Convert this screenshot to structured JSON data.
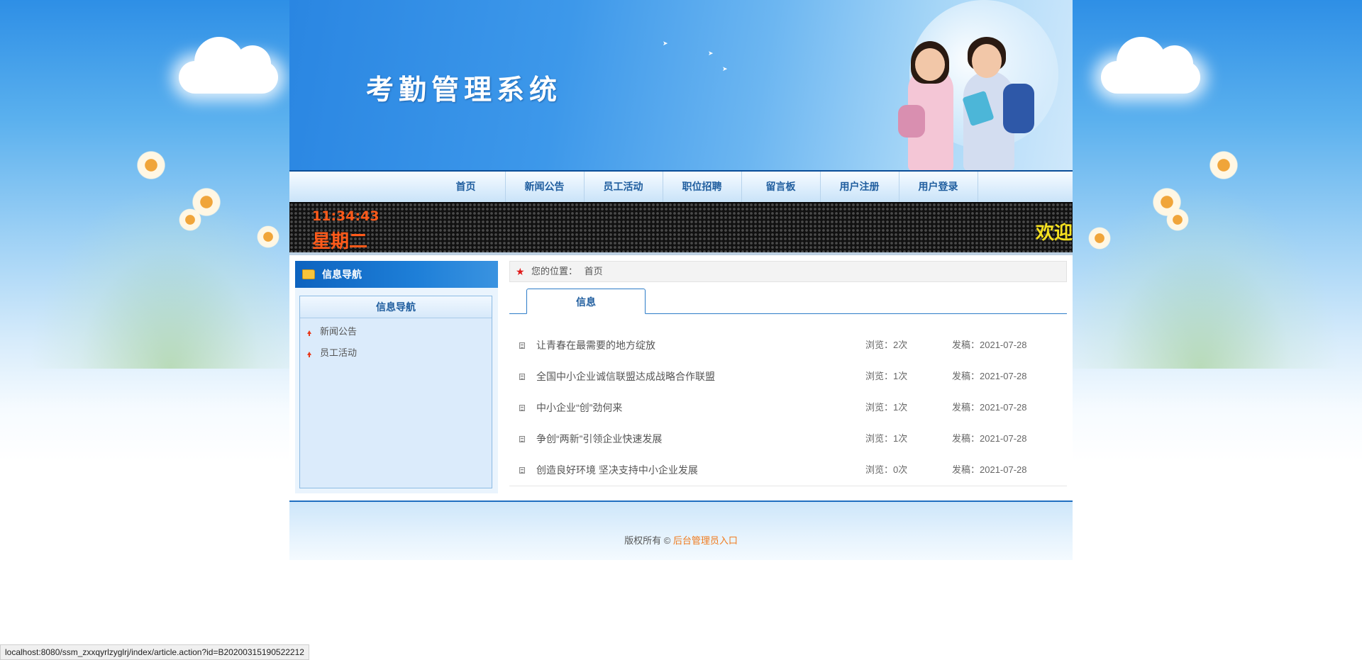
{
  "banner": {
    "site_title": "考勤管理系统"
  },
  "nav": {
    "items": [
      "首页",
      "新闻公告",
      "员工活动",
      "职位招聘",
      "留言板",
      "用户注册",
      "用户登录"
    ]
  },
  "clock": {
    "time": "11:34:43",
    "weekday": "星期二",
    "marquee": "欢迎"
  },
  "sidebar": {
    "header": "信息导航",
    "box_title": "信息导航",
    "links": [
      "新闻公告",
      "员工活动"
    ]
  },
  "breadcrumb": {
    "label": "您的位置：",
    "current": "首页"
  },
  "tab": {
    "label": "信息"
  },
  "articles": [
    {
      "title": "让青春在最需要的地方绽放",
      "views": "浏览：2次",
      "date": "发稿：2021-07-28"
    },
    {
      "title": "全国中小企业诚信联盟达成战略合作联盟",
      "views": "浏览：1次",
      "date": "发稿：2021-07-28"
    },
    {
      "title": "中小企业“创”劲何来",
      "views": "浏览：1次",
      "date": "发稿：2021-07-28"
    },
    {
      "title": "争创“两新”引领企业快速发展",
      "views": "浏览：1次",
      "date": "发稿：2021-07-28"
    },
    {
      "title": "创造良好环境 坚决支持中小企业发展",
      "views": "浏览：0次",
      "date": "发稿：2021-07-28"
    }
  ],
  "footer": {
    "copyright": "版权所有 ©",
    "admin_link": "后台管理员入口"
  },
  "status_bar": {
    "url": "localhost:8080/ssm_zxxqyrlzyglrj/index/article.action?id=B20200315190522212"
  },
  "colors": {
    "nav_text": "#1f5d9e",
    "accent_orange": "#f07b1e",
    "led_time": "#ff5a1a",
    "led_marquee": "#f5e01f"
  }
}
